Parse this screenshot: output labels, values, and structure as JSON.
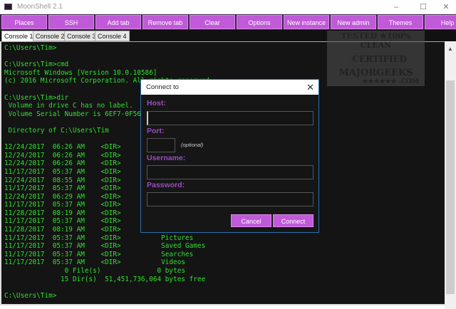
{
  "window": {
    "title": "MoonShell 2.1",
    "minimize": "–",
    "maximize": "☐",
    "close": "✕"
  },
  "toolbar": [
    "Places",
    "SSH",
    "Add tab",
    "Remove tab",
    "Clear",
    "Options",
    "New instance",
    "New admin",
    "Themes",
    "Help"
  ],
  "tabs": [
    "Console 1",
    "Console 2",
    "Console 3",
    "Console 4"
  ],
  "console_text": "C:\\Users\\Tim>\n\nC:\\Users\\Tim>cmd\nMicrosoft Windows [Version 10.0.10586]\n(c) 2016 Microsoft Corporation. All rights reserved.\n\nC:\\Users\\Tim>dir\n Volume in drive C has no label.\n Volume Serial Number is 6EF7-0F56\n\n Directory of C:\\Users\\Tim\n\n12/24/2017  06:26 AM    <DIR>\n12/24/2017  06:26 AM    <DIR>\n12/24/2017  06:26 AM    <DIR>\n11/17/2017  05:37 AM    <DIR>\n12/24/2017  08:55 AM    <DIR>\n11/17/2017  05:37 AM    <DIR>\n12/24/2017  06:29 AM    <DIR>\n11/17/2017  05:37 AM    <DIR>\n11/28/2017  08:19 AM    <DIR>\n11/17/2017  05:37 AM    <DIR>\n11/28/2017  08:19 AM    <DIR>\n11/17/2017  05:37 AM    <DIR>          Pictures\n11/17/2017  05:37 AM    <DIR>          Saved Games\n11/17/2017  05:37 AM    <DIR>          Searches\n11/17/2017  05:37 AM    <DIR>          Videos\n               0 File(s)              0 bytes\n              15 Dir(s)  51,451,736,064 bytes free\n\nC:\\Users\\Tim>",
  "watermark": {
    "line1": "TESTED ★100% CLEAN",
    "line2": "CERTIFIED",
    "line3": "MAJORGEEKS",
    "line4": "★★★★★★ .COM"
  },
  "dialog": {
    "title": "Connect to",
    "close": "✕",
    "host_label": "Host:",
    "host_value": "",
    "port_label": "Port:",
    "port_value": "",
    "port_hint": "(optional)",
    "username_label": "Username:",
    "username_value": "",
    "password_label": "Password:",
    "password_value": "",
    "cancel": "Cancel",
    "connect": "Connect"
  },
  "colors": {
    "accent": "#c05ad8",
    "console_text": "#2ee02e",
    "label": "#9a4cc0"
  }
}
